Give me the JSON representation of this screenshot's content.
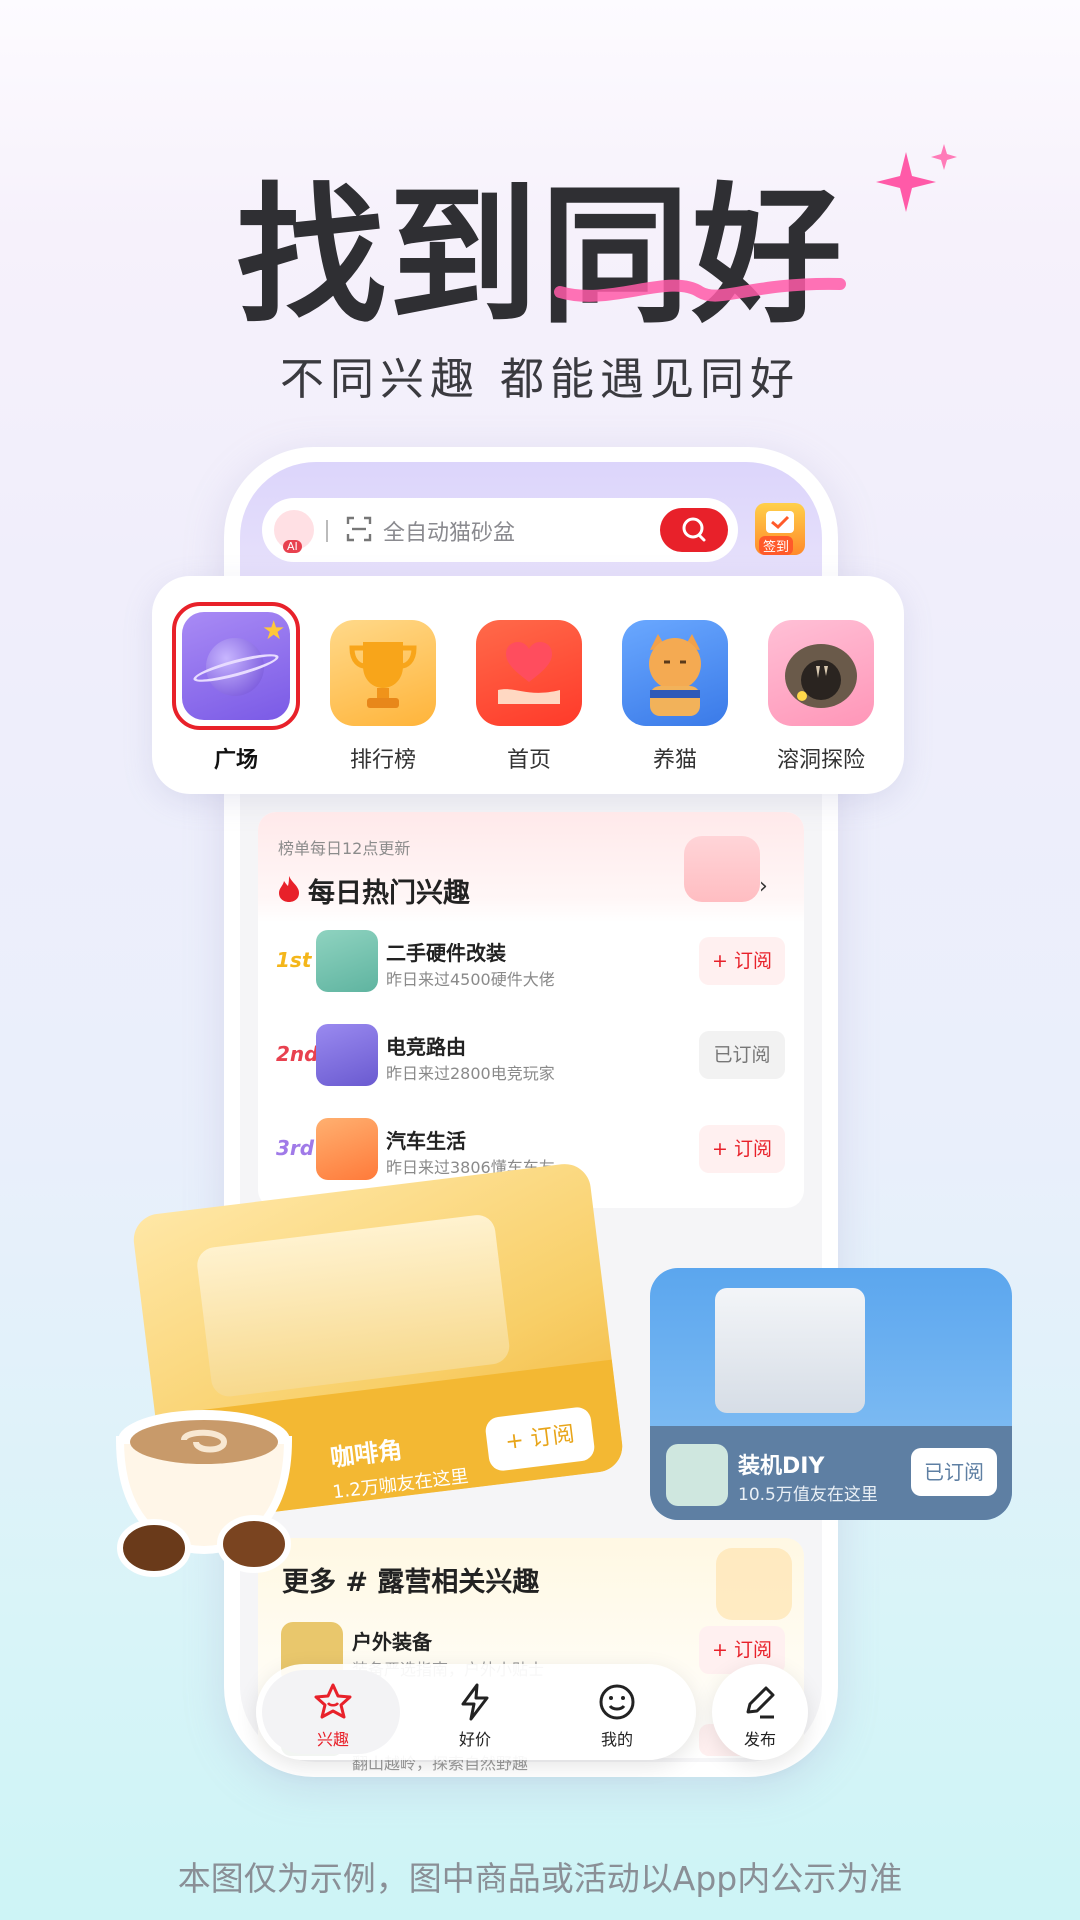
{
  "headline": {
    "title": "找到同好",
    "subtitle": "不同兴趣  都能遇见同好"
  },
  "search": {
    "placeholder": "全自动猫砂盆",
    "signin_label": "签到",
    "avatar_badge": "AI"
  },
  "nav": {
    "items": [
      {
        "label": "广场",
        "active": true
      },
      {
        "label": "排行榜",
        "active": false
      },
      {
        "label": "首页",
        "active": false
      },
      {
        "label": "养猫",
        "active": false
      },
      {
        "label": "溶洞探险",
        "active": false
      }
    ]
  },
  "hot": {
    "note": "榜单每日12点更新",
    "title": "每日热门兴趣",
    "items": [
      {
        "rank": "1st",
        "name": "二手硬件改装",
        "sub": "昨日来过4500硬件大佬",
        "button": "+ 订阅",
        "subscribed": false
      },
      {
        "rank": "2nd",
        "name": "电竞路由",
        "sub": "昨日来过2800电竞玩家",
        "button": "已订阅",
        "subscribed": true
      },
      {
        "rank": "3rd",
        "name": "汽车生活",
        "sub": "昨日来过3806懂车车友",
        "button": "+ 订阅",
        "subscribed": false
      }
    ]
  },
  "featured": {
    "coffee": {
      "name": "咖啡角",
      "sub": "1.2万咖友在这里",
      "button": "+ 订阅"
    },
    "diy": {
      "name": "装机DIY",
      "sub": "10.5万值友在这里",
      "button": "已订阅"
    }
  },
  "more": {
    "title": "更多 # 露营相关兴趣",
    "items": [
      {
        "name": "户外装备",
        "sub": "装备严选指南，户外小贴士",
        "button": "+ 订阅"
      },
      {
        "name": "",
        "sub": "翻山越岭，探索自然野趣",
        "button": "+"
      }
    ]
  },
  "tabbar": {
    "items": [
      {
        "label": "兴趣",
        "icon": "star-face-icon",
        "active": true
      },
      {
        "label": "好价",
        "icon": "bolt-icon",
        "active": false
      },
      {
        "label": "我的",
        "icon": "smile-icon",
        "active": false
      }
    ],
    "publish_label": "发布"
  },
  "disclaimer": "本图仅为示例，图中商品或活动以App内公示为准",
  "colors": {
    "accent": "#e8212a",
    "coffee": "#f3b833",
    "diy": "#5e7fa3",
    "headline": "#2f2f33"
  }
}
